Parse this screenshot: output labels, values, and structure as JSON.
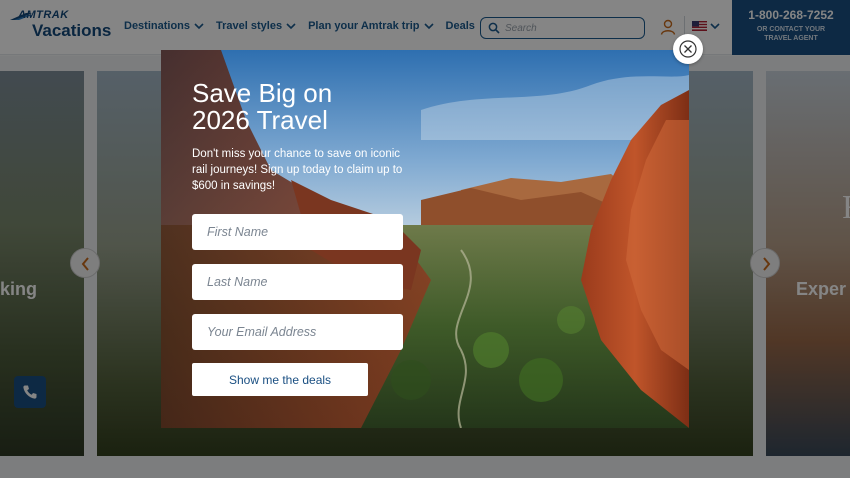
{
  "header": {
    "logo_top": "AMTRAK",
    "logo_bottom": "Vacations",
    "nav": [
      {
        "label": "Destinations"
      },
      {
        "label": "Travel styles"
      },
      {
        "label": "Plan your Amtrak trip"
      },
      {
        "label": "Deals"
      }
    ],
    "search_placeholder": "Search",
    "phone_number": "1-800-268-7252",
    "phone_sub": "OR CONTACT YOUR TRAVEL AGENT",
    "language_flag": "us-flag-icon"
  },
  "background": {
    "left_card_label": "king",
    "right_card_label": "Exper",
    "right_card_glyph": "F"
  },
  "modal": {
    "title_line1": "Save Big on",
    "title_line2": "2026 Travel",
    "body": "Don't miss your chance to save on iconic rail journeys! Sign up today to claim up to $600 in savings!",
    "first_name_placeholder": "First Name",
    "last_name_placeholder": "Last Name",
    "email_placeholder": "Your Email Address",
    "cta_label": "Show me the deals"
  },
  "colors": {
    "brand_blue": "#1a4f82",
    "nav_blue": "#1c5b8f",
    "white": "#ffffff"
  }
}
